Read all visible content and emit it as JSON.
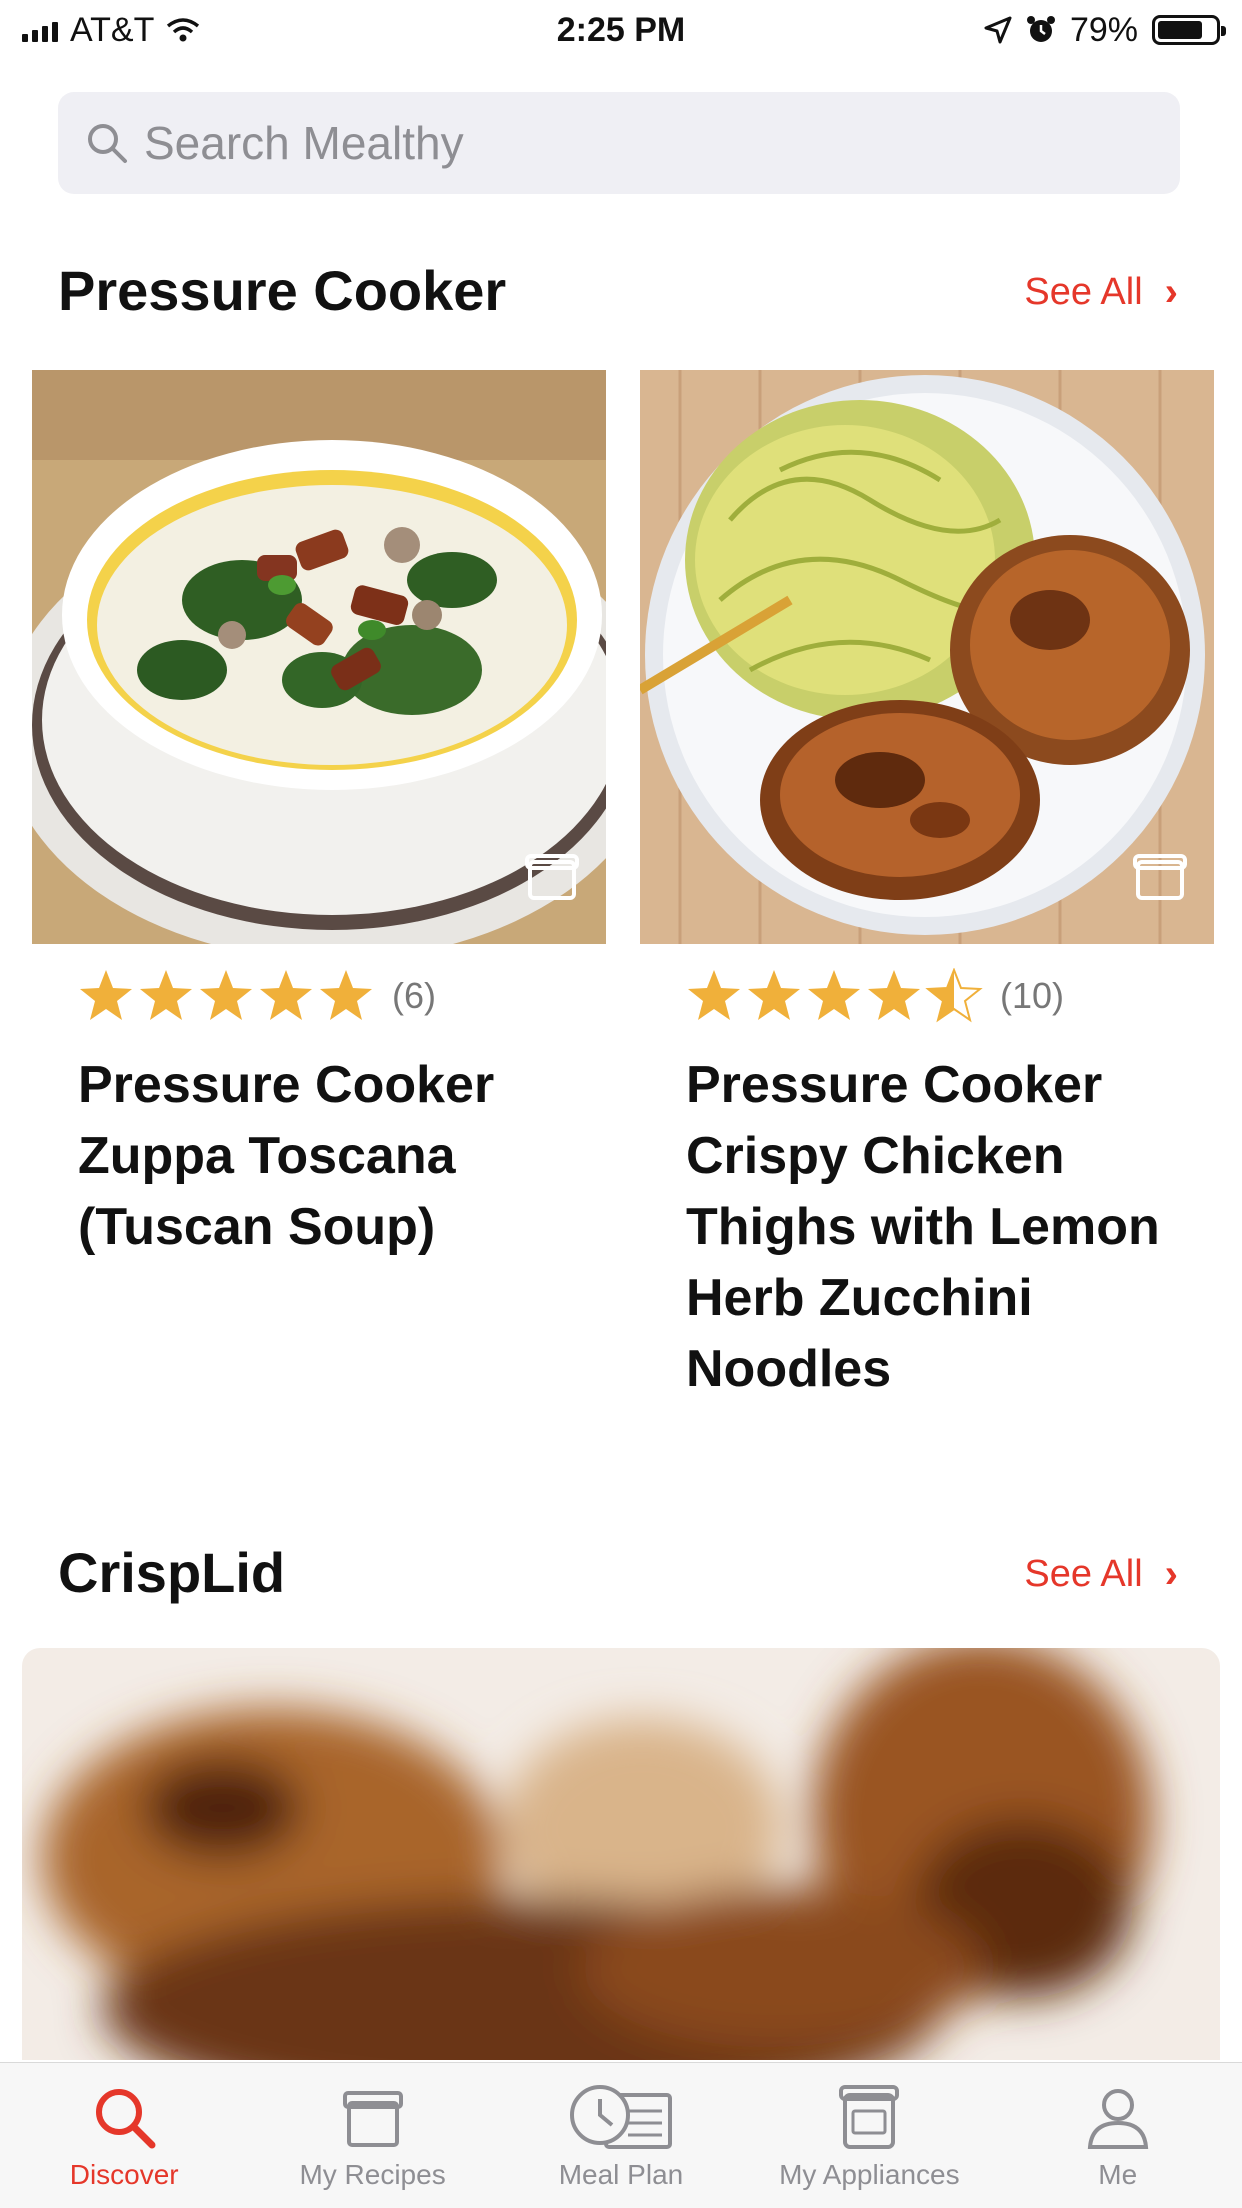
{
  "status_bar": {
    "carrier": "AT&T",
    "time": "2:25 PM",
    "battery": "79%"
  },
  "search": {
    "placeholder": "Search Mealthy"
  },
  "sections": [
    {
      "title": "Pressure Cooker",
      "see_all": "See All"
    },
    {
      "title": "CrispLid",
      "see_all": "See All"
    }
  ],
  "recipes": [
    {
      "title": "Pressure Cooker Zuppa Toscana (Tuscan Soup)",
      "rating": 5,
      "rating_count": "(6)"
    },
    {
      "title": "Pressure Cooker Crispy Chicken Thighs with Lemon Herb Zucchini Noodles",
      "rating": 4.5,
      "rating_count": "(10)"
    }
  ],
  "tabs": [
    {
      "label": "Discover",
      "icon": "search-icon",
      "active": true
    },
    {
      "label": "My Recipes",
      "icon": "recipe-box-icon",
      "active": false
    },
    {
      "label": "Meal Plan",
      "icon": "clock-list-icon",
      "active": false
    },
    {
      "label": "My Appliances",
      "icon": "appliance-icon",
      "active": false
    },
    {
      "label": "Me",
      "icon": "person-icon",
      "active": false
    }
  ],
  "colors": {
    "accent": "#e5372a",
    "star": "#f0b03a",
    "inactive": "#8e8e93"
  }
}
